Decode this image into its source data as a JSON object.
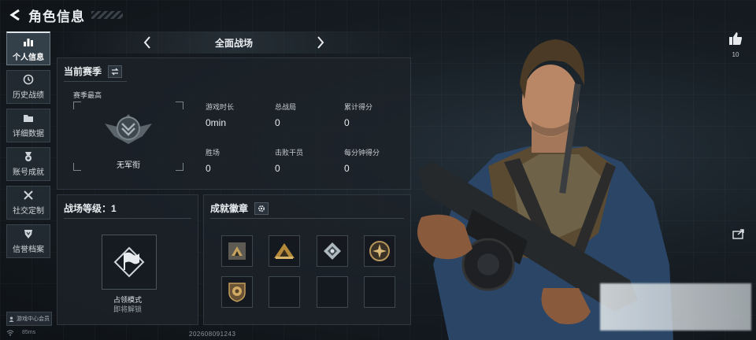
{
  "header": {
    "title": "角色信息",
    "back_icon": "back-arrow-icon"
  },
  "sidebar": {
    "items": [
      {
        "label": "个人信息",
        "icon": "bar-chart-icon",
        "active": true
      },
      {
        "label": "历史战绩",
        "icon": "clock-icon",
        "active": false
      },
      {
        "label": "详细数据",
        "icon": "folder-icon",
        "active": false
      },
      {
        "label": "账号成就",
        "icon": "medal-icon",
        "active": false
      },
      {
        "label": "社交定制",
        "icon": "tools-icon",
        "active": false
      },
      {
        "label": "信誉档案",
        "icon": "shield-icon",
        "active": false
      }
    ],
    "service_label": "游戏中心会员"
  },
  "mode_selector": {
    "label": "全面战场"
  },
  "season": {
    "title": "当前赛季",
    "best_label": "赛季最高",
    "rank_name": "无军衔",
    "stats": [
      {
        "label": "游戏时长",
        "value": "0min"
      },
      {
        "label": "总战局",
        "value": "0"
      },
      {
        "label": "累计得分",
        "value": "0"
      },
      {
        "label": "胜场",
        "value": "0"
      },
      {
        "label": "击败干员",
        "value": "0"
      },
      {
        "label": "每分钟得分",
        "value": "0"
      }
    ]
  },
  "level": {
    "title": "战场等级：1",
    "mode_name": "占领模式",
    "mode_status": "即将解锁"
  },
  "achievements": {
    "title": "成就徽章"
  },
  "likes": {
    "count": "10"
  },
  "footer": {
    "ping": "85ms",
    "uid": "202608091243"
  },
  "colors": {
    "background": "#11161b",
    "panel": "#1c2228",
    "accent": "#e8ecef"
  }
}
